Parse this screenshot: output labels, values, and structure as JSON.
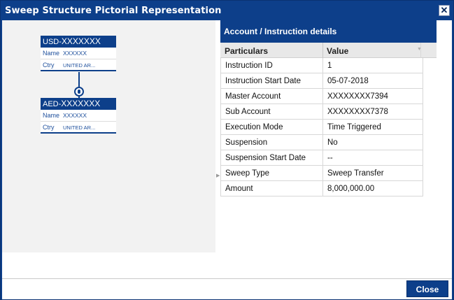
{
  "window": {
    "title": "Sweep Structure Pictorial Representation",
    "close_glyph": "✕"
  },
  "tree": {
    "nodes": [
      {
        "ccy": "USD-",
        "account": "XXXXXXX",
        "name_label": "Name",
        "name_value": "XXXXXX",
        "ctry_label": "Ctry",
        "ctry_value": "UNITED AR..."
      },
      {
        "ccy": "AED-",
        "account": "XXXXXXX",
        "name_label": "Name",
        "name_value": "XXXXXX",
        "ctry_label": "Ctry",
        "ctry_value": "UNITED AR..."
      }
    ]
  },
  "details": {
    "heading": "Account / Instruction details",
    "columns": [
      "Particulars",
      "Value"
    ],
    "rows": [
      {
        "k": "Instruction ID",
        "v": "1"
      },
      {
        "k": "Instruction Start Date",
        "v": "05-07-2018"
      },
      {
        "k": "Master Account",
        "v": "XXXXXXXX7394"
      },
      {
        "k": "Sub Account",
        "v": "XXXXXXXX7378"
      },
      {
        "k": "Execution Mode",
        "v": "Time Triggered"
      },
      {
        "k": "Suspension",
        "v": "No"
      },
      {
        "k": "Suspension Start Date",
        "v": "--"
      },
      {
        "k": "Sweep Type",
        "v": "Sweep Transfer"
      },
      {
        "k": "Amount",
        "v": "8,000,000.00"
      }
    ]
  },
  "footer": {
    "close_label": "Close"
  },
  "colors": {
    "brand": "#0d3f8a",
    "pane_bg": "#f2f2f2"
  }
}
